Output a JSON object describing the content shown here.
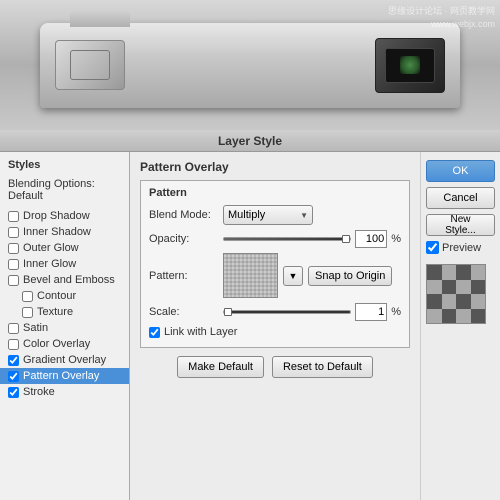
{
  "watermark": {
    "line1": "思缘设计论坛 · 网页教学网",
    "line2": "www.webjx.com"
  },
  "dialog": {
    "title": "Layer Style"
  },
  "styles_panel": {
    "header": "Styles",
    "blend_options": "Blending Options: Default",
    "items": [
      {
        "id": "drop-shadow",
        "label": "Drop Shadow",
        "checked": false,
        "indent": false
      },
      {
        "id": "inner-shadow",
        "label": "Inner Shadow",
        "checked": false,
        "indent": false
      },
      {
        "id": "outer-glow",
        "label": "Outer Glow",
        "checked": false,
        "indent": false
      },
      {
        "id": "inner-glow",
        "label": "Inner Glow",
        "checked": false,
        "indent": false
      },
      {
        "id": "bevel-emboss",
        "label": "Bevel and Emboss",
        "checked": false,
        "indent": false
      },
      {
        "id": "contour",
        "label": "Contour",
        "checked": false,
        "indent": true
      },
      {
        "id": "texture",
        "label": "Texture",
        "checked": false,
        "indent": true
      },
      {
        "id": "satin",
        "label": "Satin",
        "checked": false,
        "indent": false
      },
      {
        "id": "color-overlay",
        "label": "Color Overlay",
        "checked": false,
        "indent": false
      },
      {
        "id": "gradient-overlay",
        "label": "Gradient Overlay",
        "checked": true,
        "indent": false
      },
      {
        "id": "pattern-overlay",
        "label": "Pattern Overlay",
        "checked": true,
        "indent": false,
        "selected": true
      },
      {
        "id": "stroke",
        "label": "Stroke",
        "checked": true,
        "indent": false
      }
    ]
  },
  "main": {
    "section_title": "Pattern Overlay",
    "subsection_title": "Pattern",
    "blend_mode_label": "Blend Mode:",
    "blend_mode_value": "Multiply",
    "opacity_label": "Opacity:",
    "opacity_value": "100",
    "opacity_unit": "%",
    "pattern_label": "Pattern:",
    "snap_to_origin_label": "Snap to Origin",
    "scale_label": "Scale:",
    "scale_value": "1",
    "scale_unit": "%",
    "link_with_layer_label": "Link with Layer",
    "link_with_layer_checked": true,
    "make_default_label": "Make Default",
    "reset_to_default_label": "Reset to Default"
  },
  "right_panel": {
    "ok_label": "OK",
    "cancel_label": "Cancel",
    "new_style_label": "New Style...",
    "preview_label": "Preview"
  }
}
